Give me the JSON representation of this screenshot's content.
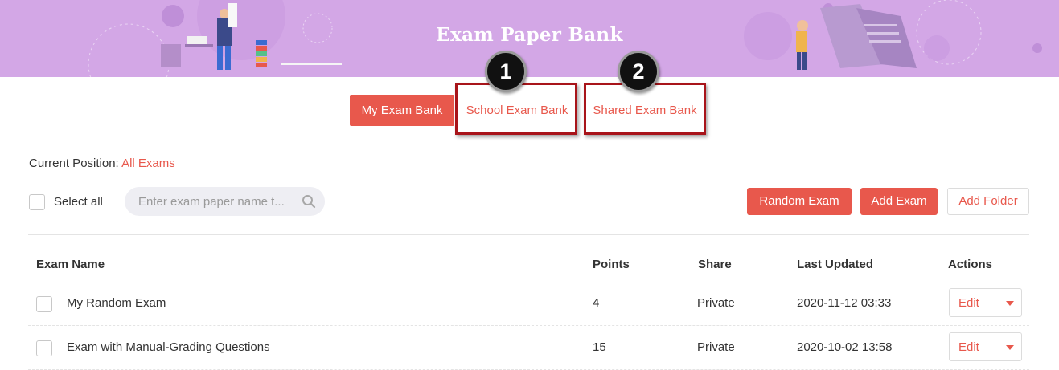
{
  "banner": {
    "title": "Exam Paper Bank"
  },
  "tabs": [
    {
      "label": "My Exam Bank",
      "active": true
    },
    {
      "label": "School Exam Bank",
      "active": false
    },
    {
      "label": "Shared Exam Bank",
      "active": false
    }
  ],
  "callouts": [
    "1",
    "2"
  ],
  "position": {
    "label": "Current Position:",
    "value": "All Exams"
  },
  "toolbar": {
    "select_all": "Select all",
    "search_placeholder": "Enter exam paper name t...",
    "random_exam": "Random Exam",
    "add_exam": "Add Exam",
    "add_folder": "Add Folder"
  },
  "table": {
    "headers": {
      "name": "Exam Name",
      "points": "Points",
      "share": "Share",
      "updated": "Last Updated",
      "actions": "Actions"
    },
    "rows": [
      {
        "name": "My Random Exam",
        "points": "4",
        "share": "Private",
        "updated": "2020-11-12 03:33",
        "action": "Edit"
      },
      {
        "name": "Exam with Manual-Grading Questions",
        "points": "15",
        "share": "Private",
        "updated": "2020-10-02 13:58",
        "action": "Edit"
      }
    ]
  },
  "colors": {
    "accent": "#e8584c",
    "banner": "#d3a7e6",
    "callout_border": "#a8141a"
  }
}
